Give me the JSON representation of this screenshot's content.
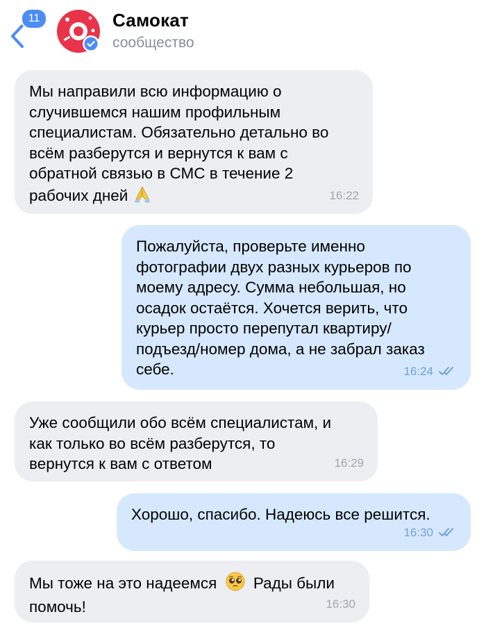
{
  "header": {
    "back_badge": "11",
    "title": "Самокат",
    "subtitle": "сообщество"
  },
  "colors": {
    "incoming_bubble": "#eceef2",
    "outgoing_bubble": "#d6e8fd",
    "accent": "#4c8cf5",
    "brand": "#e7344a"
  },
  "messages": [
    {
      "direction": "incoming",
      "text": "Мы направили всю информацию о\nслучившемся нашим профильным\nспециалистам. Обязательно детально во\nвсём разберутся и вернутся к вам с\nобратной связью в СМС в течение 2\nрабочих дней",
      "emoji": "folded-hands-emoji",
      "time": "16:22"
    },
    {
      "direction": "outgoing",
      "text": "Пожалуйста, проверьте именно\nфотографии двух разных курьеров по\nмоему адресу. Сумма небольшая, но\nосадок остаётся. Хочется верить, что\nкурьер просто перепутал квартиру/\nподъезд/номер дома, а не забрал заказ\nсебе.",
      "time": "16:24",
      "status": "read"
    },
    {
      "direction": "incoming",
      "text": "Уже сообщили обо всём специалистам, и\nкак только во всём разберутся, то\nвернутся к вам с ответом",
      "time": "16:29"
    },
    {
      "direction": "outgoing",
      "text": "Хорошо, спасибо. Надеюсь все решится.",
      "time": "16:30",
      "status": "read"
    },
    {
      "direction": "incoming",
      "text_before_emoji": "Мы тоже на это надеемся",
      "emoji": "pleading-face-emoji",
      "text_after_emoji": "Рады были\nпомочь!",
      "time": "16:30"
    }
  ]
}
